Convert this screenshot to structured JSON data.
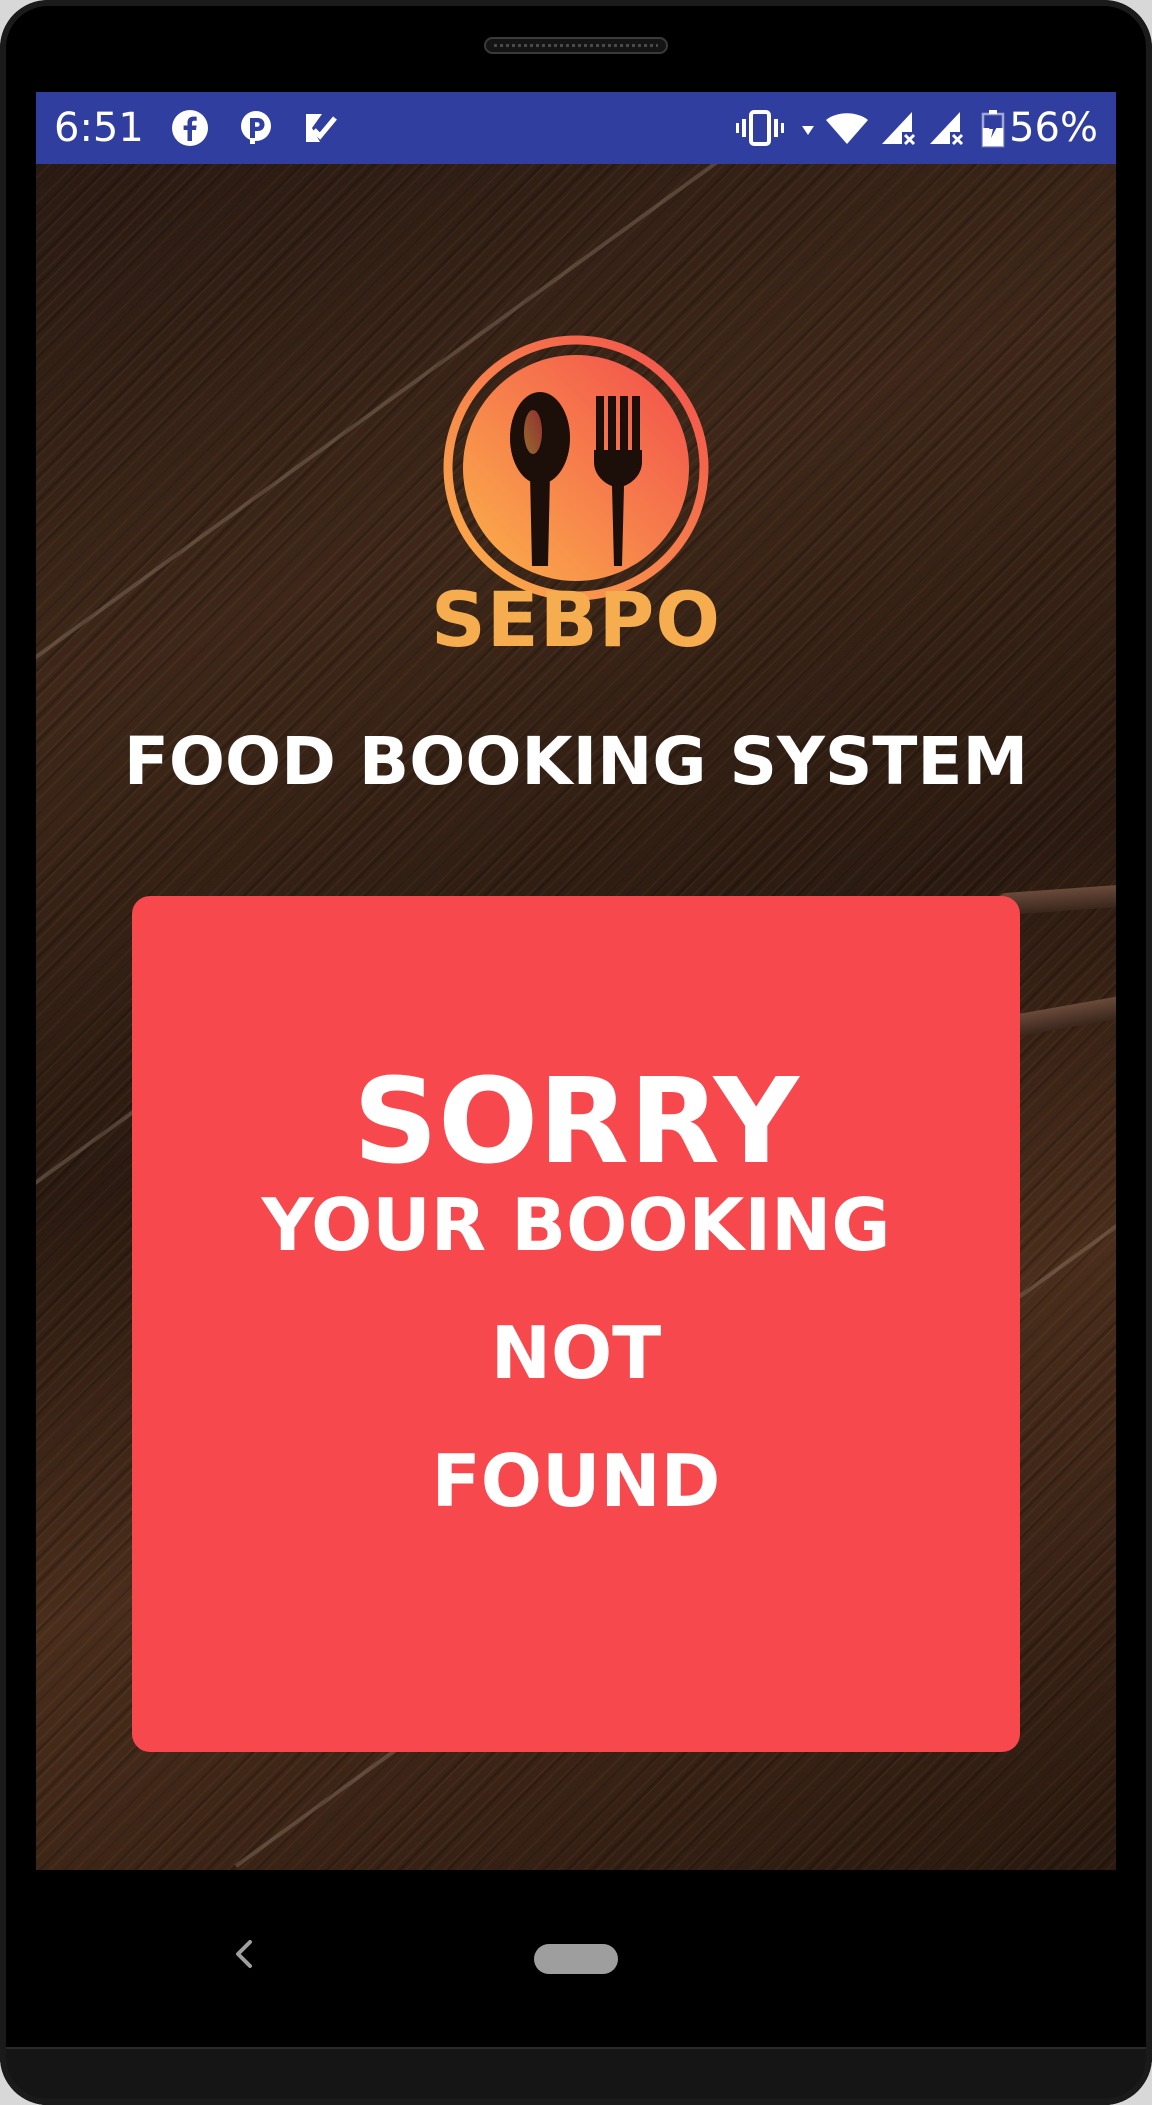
{
  "status_bar": {
    "time": "6:51",
    "battery_percent": "56%",
    "background_color": "#303f9f",
    "notification_icons": [
      "facebook-icon",
      "parking-icon",
      "task-check-icon"
    ],
    "system_icons": [
      "vibrate-icon",
      "wifi-icon",
      "signal-icon",
      "signal-icon",
      "battery-icon"
    ]
  },
  "app": {
    "brand": "SEBPO",
    "subtitle": "FOOD BOOKING SYSTEM",
    "logo_icon": "spoon-fork-icon",
    "brand_color": "#f5ad50"
  },
  "message": {
    "title": "SORRY",
    "line1": "YOUR BOOKING",
    "line2": "NOT",
    "line3": "FOUND",
    "card_color": "#f7484d"
  },
  "navigation": {
    "back_icon": "back-icon",
    "home_icon": "home-pill-icon"
  }
}
